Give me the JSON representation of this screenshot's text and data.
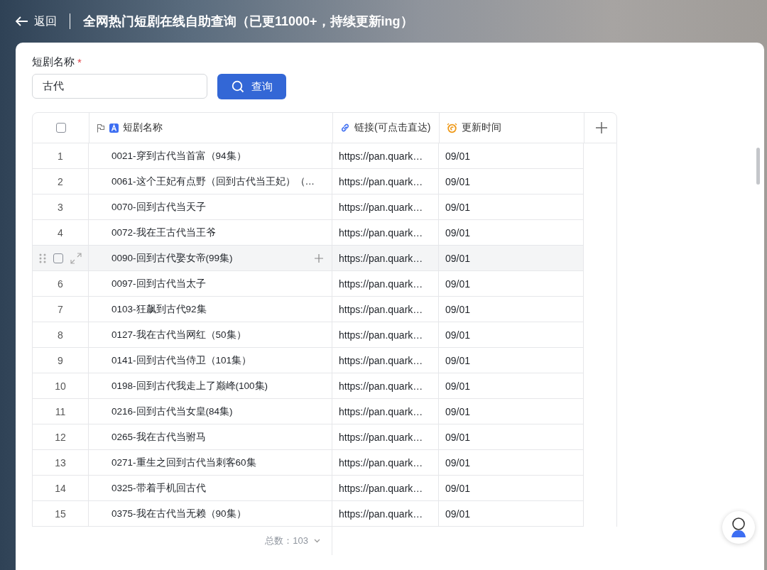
{
  "header": {
    "back_label": "返回",
    "title": "全网热门短剧在线自助查询（已更11000+，持续更新ing）"
  },
  "query": {
    "label": "短剧名称",
    "required_mark": "*",
    "value": "古代",
    "button": "查询"
  },
  "table": {
    "checked": false,
    "columns": [
      {
        "label": "短剧名称",
        "kind": "text"
      },
      {
        "label": "链接(可点击直达)",
        "kind": "link"
      },
      {
        "label": "更新时间",
        "kind": "date"
      }
    ],
    "rows": [
      {
        "index": "1",
        "name": "0021-穿到古代当首富（94集）",
        "link": "https://pan.quark…",
        "date": "09/01",
        "hovered": false
      },
      {
        "index": "2",
        "name": "0061-这个王妃有点野（回到古代当王妃）（…",
        "link": "https://pan.quark…",
        "date": "09/01",
        "hovered": false
      },
      {
        "index": "3",
        "name": "0070-回到古代当天子",
        "link": "https://pan.quark…",
        "date": "09/01",
        "hovered": false
      },
      {
        "index": "4",
        "name": "0072-我在王古代当王爷",
        "link": "https://pan.quark…",
        "date": "09/01",
        "hovered": false
      },
      {
        "name": "0090-回到古代娶女帝(99集)",
        "link": "https://pan.quark…",
        "date": "09/01",
        "hovered": true
      },
      {
        "index": "6",
        "name": "0097-回到古代当太子",
        "link": "https://pan.quark…",
        "date": "09/01",
        "hovered": false
      },
      {
        "index": "7",
        "name": "0103-狂飙到古代92集",
        "link": "https://pan.quark…",
        "date": "09/01",
        "hovered": false
      },
      {
        "index": "8",
        "name": "0127-我在古代当网红（50集）",
        "link": "https://pan.quark…",
        "date": "09/01",
        "hovered": false
      },
      {
        "index": "9",
        "name": "0141-回到古代当侍卫（101集）",
        "link": "https://pan.quark…",
        "date": "09/01",
        "hovered": false
      },
      {
        "index": "10",
        "name": "0198-回到古代我走上了巅峰(100集)",
        "link": "https://pan.quark…",
        "date": "09/01",
        "hovered": false
      },
      {
        "index": "11",
        "name": "0216-回到古代当女皇(84集)",
        "link": "https://pan.quark…",
        "date": "09/01",
        "hovered": false
      },
      {
        "index": "12",
        "name": "0265-我在古代当驸马",
        "link": "https://pan.quark…",
        "date": "09/01",
        "hovered": false
      },
      {
        "index": "13",
        "name": "0271-重生之回到古代当刺客60集",
        "link": "https://pan.quark…",
        "date": "09/01",
        "hovered": false
      },
      {
        "index": "14",
        "name": "0325-带着手机回古代",
        "link": "https://pan.quark…",
        "date": "09/01",
        "hovered": false
      },
      {
        "index": "15",
        "name": "0375-我在古代当无赖（90集）",
        "link": "https://pan.quark…",
        "date": "09/01",
        "hovered": false
      }
    ],
    "footer": {
      "total_label": "总数：",
      "total": "103"
    }
  }
}
